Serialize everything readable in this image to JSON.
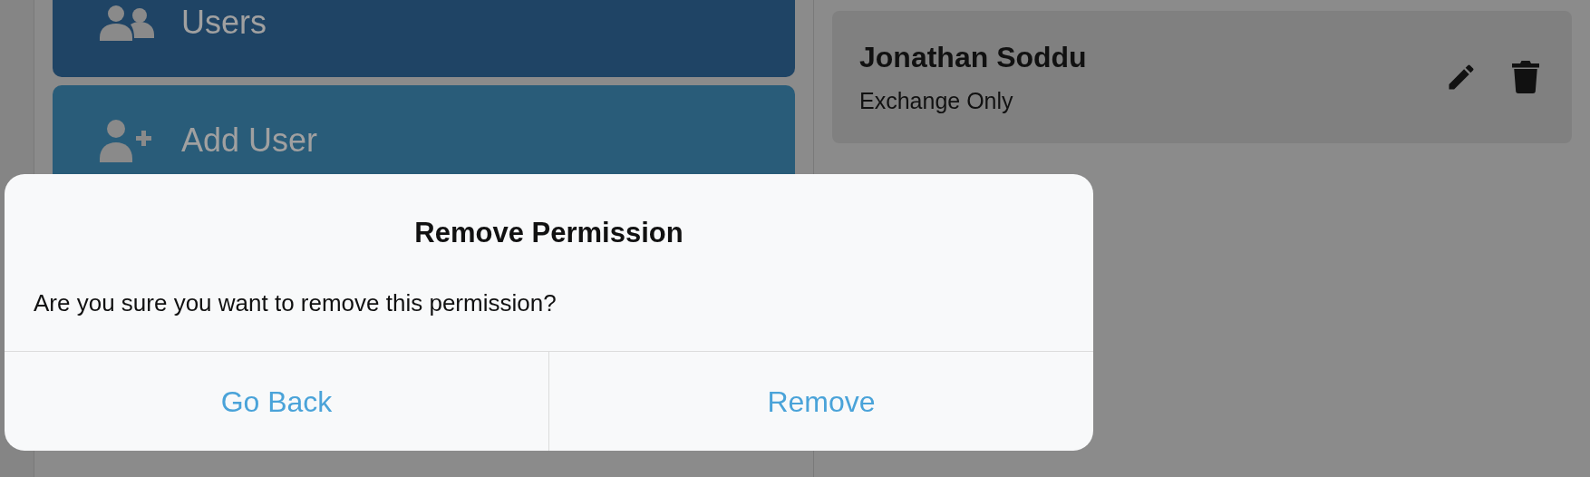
{
  "sidebar": {
    "items": [
      {
        "label": "Users",
        "kind": "users",
        "selected": true
      },
      {
        "label": "Add User",
        "kind": "add-user",
        "selected": false
      }
    ]
  },
  "permissions": [
    {
      "name": "Jonathan Soddu",
      "role": "Exchange Only"
    }
  ],
  "dialog": {
    "title": "Remove Permission",
    "message": "Are you sure you want to remove this permission?",
    "buttons": [
      "Go Back",
      "Remove"
    ]
  }
}
